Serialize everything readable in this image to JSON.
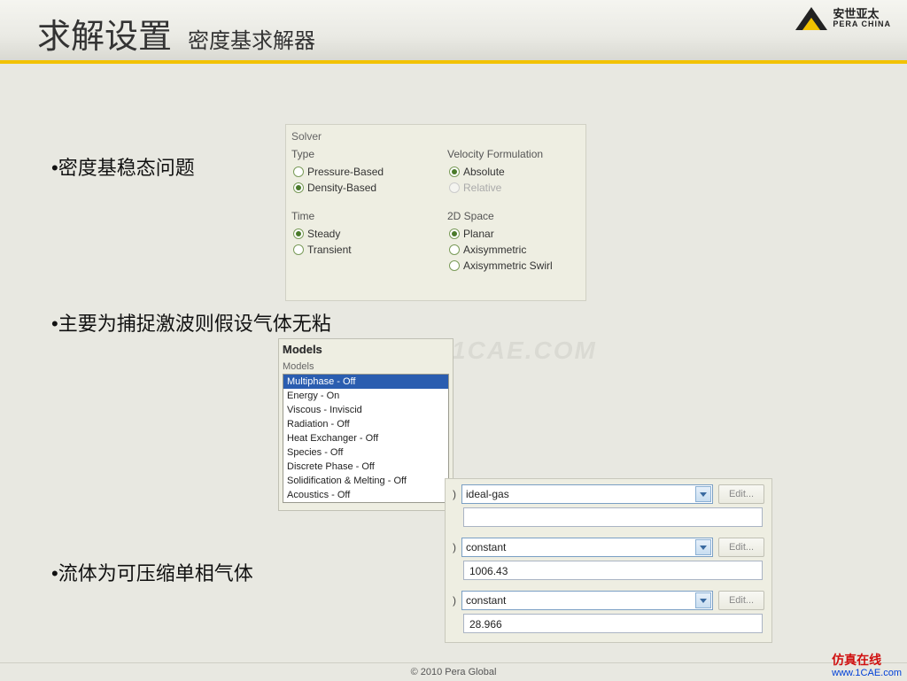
{
  "header": {
    "title": "求解设置",
    "subtitle": "密度基求解器",
    "logo_cn": "安世亚太",
    "logo_en": "PERA CHINA"
  },
  "bullets": {
    "b1": "•密度基稳态问题",
    "b2": "•主要为捕捉激波则假设气体无粘",
    "b3": "•流体为可压缩单相气体"
  },
  "solver": {
    "title": "Solver",
    "type_label": "Type",
    "type_options": [
      "Pressure-Based",
      "Density-Based"
    ],
    "type_selected": 1,
    "velocity_label": "Velocity Formulation",
    "velocity_options": [
      "Absolute",
      "Relative"
    ],
    "velocity_selected": 0,
    "velocity_disabled": [
      false,
      true
    ],
    "time_label": "Time",
    "time_options": [
      "Steady",
      "Transient"
    ],
    "time_selected": 0,
    "space_label": "2D Space",
    "space_options": [
      "Planar",
      "Axisymmetric",
      "Axisymmetric Swirl"
    ],
    "space_selected": 0
  },
  "models": {
    "panel_title": "Models",
    "list_label": "Models",
    "items": [
      "Multiphase - Off",
      "Energy - On",
      "Viscous - Inviscid",
      "Radiation - Off",
      "Heat Exchanger - Off",
      "Species - Off",
      "Discrete Phase - Off",
      "Solidification & Melting - Off",
      "Acoustics - Off"
    ],
    "selected": 0
  },
  "properties": {
    "edit_label": "Edit...",
    "rows": [
      {
        "dropdown": "ideal-gas",
        "value": ""
      },
      {
        "dropdown": "constant",
        "value": "1006.43"
      },
      {
        "dropdown": "constant",
        "value": "28.966"
      }
    ]
  },
  "watermark": "1CAE.COM",
  "footer": "© 2010 Pera Global",
  "brand": {
    "cn": "仿真在线",
    "url": "www.1CAE.com"
  }
}
